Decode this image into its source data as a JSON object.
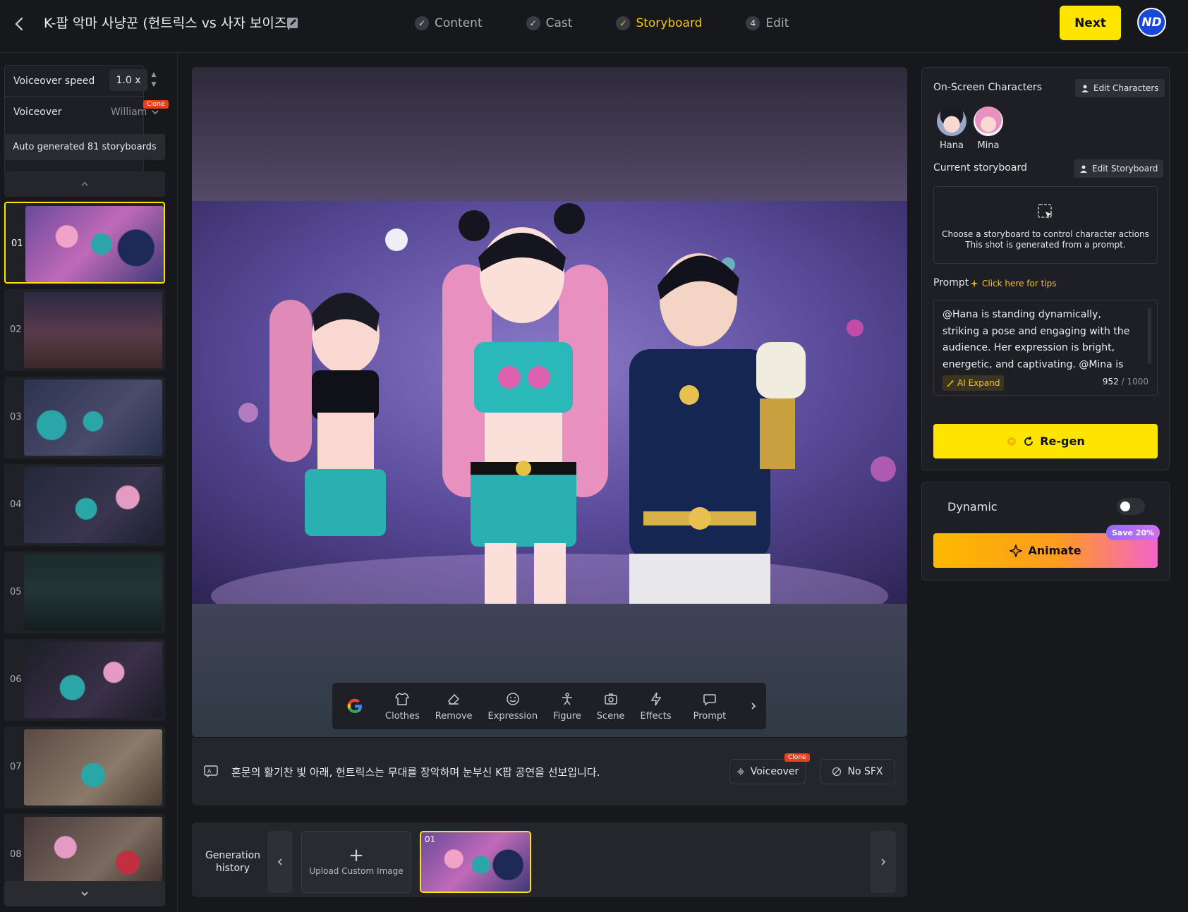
{
  "header": {
    "title": "K-팝 악마 사냥꾼 (헌트릭스 vs 사자 보이즈)",
    "steps": [
      {
        "label": "Content",
        "marker": "✓",
        "state": "done"
      },
      {
        "label": "Cast",
        "marker": "✓",
        "state": "done"
      },
      {
        "label": "Storyboard",
        "marker": "✓",
        "state": "active"
      },
      {
        "label": "Edit",
        "marker": "4",
        "state": "pending"
      }
    ],
    "next_label": "Next",
    "avatar_initials": "ND"
  },
  "sidebar": {
    "voiceover_speed_label": "Voiceover speed",
    "voiceover_speed_value": "1.0 x",
    "clone_badge": "Clone",
    "voiceover_label": "Voiceover",
    "voiceover_value": "William",
    "auto_generated": "Auto generated 81 storyboards",
    "storyboards": [
      "01",
      "02",
      "03",
      "04",
      "05",
      "06",
      "07",
      "08"
    ],
    "active_storyboard": "01"
  },
  "toolbar": {
    "tools": [
      {
        "label": "Clothes",
        "icon": "shirt-icon"
      },
      {
        "label": "Remove",
        "icon": "eraser-icon"
      },
      {
        "label": "Expression",
        "icon": "smile-icon"
      },
      {
        "label": "Figure",
        "icon": "figure-icon"
      },
      {
        "label": "Scene",
        "icon": "camera-icon"
      },
      {
        "label": "Effects",
        "icon": "bolt-icon"
      },
      {
        "label": "Prompt",
        "icon": "prompt-icon"
      }
    ]
  },
  "caption": {
    "text": "혼문의 활기찬 빛 아래, 헌트릭스는 무대를 장악하며 눈부신 K팝 공연을 선보입니다.",
    "voiceover_label": "Voiceover",
    "clone_badge": "Clone",
    "sfx_label": "No SFX"
  },
  "history": {
    "label_line1": "Generation",
    "label_line2": "history",
    "upload_label": "Upload Custom Image",
    "thumb_number": "01"
  },
  "right_panel": {
    "on_screen_label": "On-Screen Characters",
    "edit_characters": "Edit Characters",
    "characters": [
      "Hana",
      "Mina"
    ],
    "current_storyboard_label": "Current storyboard",
    "edit_storyboard": "Edit Storyboard",
    "choose_line1": "Choose a storyboard to control character actions",
    "choose_line2": "This shot is generated from a prompt.",
    "prompt_label": "Prompt",
    "tips_label": "Click here for tips",
    "prompt_text": "@Hana is standing dynamically, striking a pose and engaging with the audience. Her expression is bright, energetic, and captivating. @Mina is standing",
    "ai_expand": "AI Expand",
    "char_count": "952",
    "char_max": "/ 1000",
    "regen_label": "Re-gen",
    "dynamic_label": "Dynamic",
    "animate_label": "Animate",
    "save_badge": "Save 20%"
  },
  "colors": {
    "accent": "#fee500",
    "active_step": "#f5c518",
    "clone_badge": "#e8401c"
  }
}
